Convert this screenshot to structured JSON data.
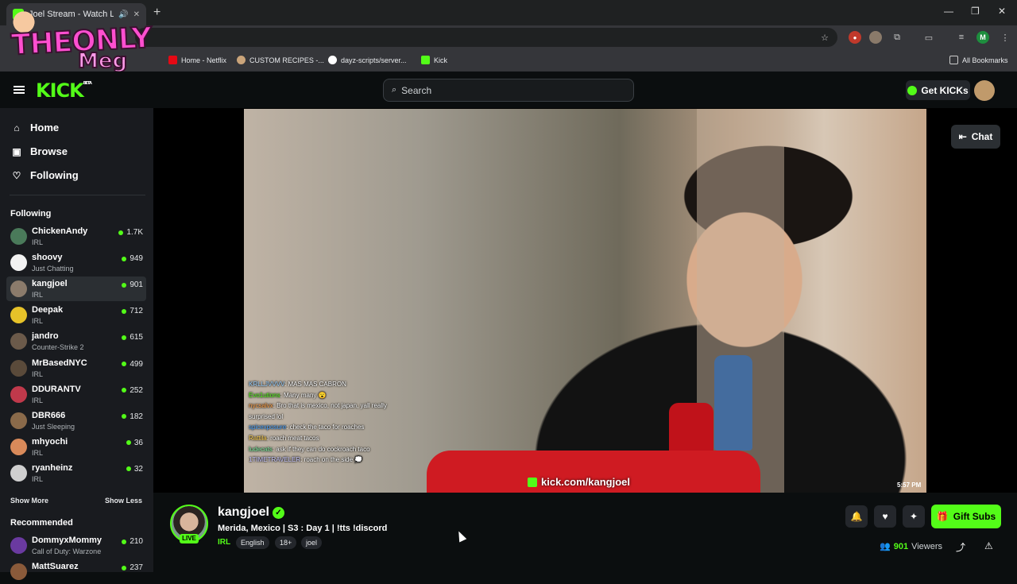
{
  "browser": {
    "tab_title": "Joel Stream - Watch Li",
    "new_tab": "+",
    "window_controls": {
      "minimize": "—",
      "maximize": "❐",
      "close": "✕"
    },
    "bookmarks": [
      {
        "label": "Home - Netflix",
        "color": "#e50914"
      },
      {
        "label": "CUSTOM RECIPES -...",
        "color": "#caa47a"
      },
      {
        "label": "dayz-scripts/server...",
        "color": "#ffffff"
      },
      {
        "label": "Kick",
        "color": "#53fc18"
      }
    ],
    "all_bookmarks": "All Bookmarks",
    "profile_initial": "M"
  },
  "overlay_logo": {
    "line1": "THEONLY",
    "line2": "Meg"
  },
  "header": {
    "logo": "KICK",
    "logo_beta": "BETA",
    "search_placeholder": "Search",
    "get_kicks": "Get KICKs"
  },
  "sidebar": {
    "nav": [
      {
        "label": "Home",
        "icon": "home-icon"
      },
      {
        "label": "Browse",
        "icon": "browse-icon"
      },
      {
        "label": "Following",
        "icon": "heart-icon"
      }
    ],
    "following_title": "Following",
    "following": [
      {
        "name": "ChickenAndy",
        "category": "IRL",
        "viewers": "1.7K",
        "color": "#4a7a5a"
      },
      {
        "name": "shoovy",
        "category": "Just Chatting",
        "viewers": "949",
        "color": "#f2f2f2"
      },
      {
        "name": "kangjoel",
        "category": "IRL",
        "viewers": "901",
        "color": "#8b7b6b",
        "active": true
      },
      {
        "name": "Deepak",
        "category": "IRL",
        "viewers": "712",
        "color": "#e6c229"
      },
      {
        "name": "jandro",
        "category": "Counter-Strike 2",
        "viewers": "615",
        "color": "#6b5a4a"
      },
      {
        "name": "MrBasedNYC",
        "category": "IRL",
        "viewers": "499",
        "color": "#5a4a3a"
      },
      {
        "name": "DDURANTV",
        "category": "IRL",
        "viewers": "252",
        "color": "#c0394b"
      },
      {
        "name": "DBR666",
        "category": "Just Sleeping",
        "viewers": "182",
        "color": "#8a6a4a"
      },
      {
        "name": "mhyochi",
        "category": "IRL",
        "viewers": "36",
        "color": "#d98a5a"
      },
      {
        "name": "ryanheinz",
        "category": "IRL",
        "viewers": "32",
        "color": "#cfcfcf"
      }
    ],
    "show_more": "Show More",
    "show_less": "Show Less",
    "recommended_title": "Recommended",
    "recommended": [
      {
        "name": "DommyxMommy",
        "category": "Call of Duty: Warzone",
        "viewers": "210",
        "color": "#6a3aa0"
      },
      {
        "name": "MattSuarez",
        "category": "",
        "viewers": "237",
        "color": "#8a5a3a"
      }
    ]
  },
  "video": {
    "chat_lines": [
      {
        "user": "KRLLJVVVV",
        "msg": "MAS MAS CABRON",
        "color": "#9ad1ff"
      },
      {
        "user": "Evo1utions",
        "msg": "Many many 😮",
        "color": "#53fc18"
      },
      {
        "user": "nycsalvx",
        "msg": "Bro that is mexico, not japan, yall really surprised lol",
        "color": "#ff9f43"
      },
      {
        "user": "spicexposure",
        "msg": "check the taco for roaches",
        "color": "#4aa3ff"
      },
      {
        "user": "Rattila",
        "msg": "roach meat tacos",
        "color": "#ffd04a"
      },
      {
        "user": "ludecats",
        "msg": "ask if they can do cockroach taco",
        "color": "#7bed9f"
      },
      {
        "user": "1TIMETRAVELER",
        "msg": "roach on the side 💭",
        "color": "#c9c9ff"
      }
    ],
    "watermark": "kick.com/kangjoel",
    "clock": "5:57 PM",
    "chat_button": "Chat"
  },
  "stream": {
    "streamer": "kangjoel",
    "live": "LIVE",
    "title": "Merida, Mexico | S3 : Day 1 | !tts !discord",
    "category": "IRL",
    "tags": [
      "English",
      "18+",
      "joel"
    ],
    "gift_subs": "Gift Subs",
    "viewers_count": "901",
    "viewers_label": "Viewers"
  },
  "colors": {
    "accent": "#53fc18",
    "bg": "#0b0e0f",
    "sidebar": "#191b1f"
  }
}
